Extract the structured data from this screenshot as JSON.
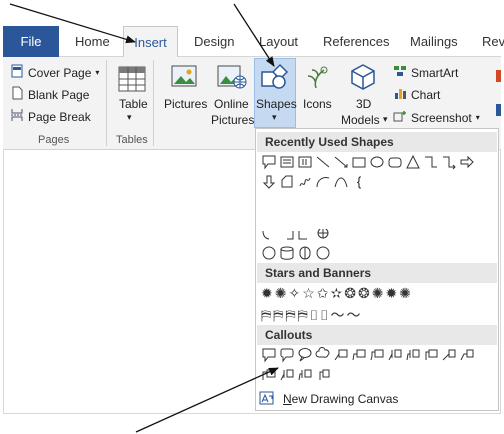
{
  "tabs": {
    "file": "File",
    "home": "Home",
    "insert": "Insert",
    "design": "Design",
    "layout": "Layout",
    "references": "References",
    "mailings": "Mailings",
    "review_partial": "Rev"
  },
  "ribbon": {
    "pages_group": {
      "label": "Pages",
      "cover_page": "Cover Page",
      "blank_page": "Blank Page",
      "page_break": "Page Break"
    },
    "tables_group": {
      "label": "Tables",
      "table": "Table"
    },
    "illustrations": {
      "pictures": "Pictures",
      "online_line1": "Online",
      "online_line2": "Pictures",
      "shapes": "Shapes",
      "icons": "Icons",
      "models_line1": "3D",
      "models_line2": "Models",
      "smartart": "SmartArt",
      "chart": "Chart",
      "screenshot": "Screenshot"
    }
  },
  "dropdown": {
    "recent_heading": "Recently Used Shapes",
    "stars_heading": "Stars and Banners",
    "callouts_heading": "Callouts",
    "recent_row2_glyph": "{",
    "new_canvas_prefix": "N",
    "new_canvas_rest": "ew Drawing Canvas"
  }
}
